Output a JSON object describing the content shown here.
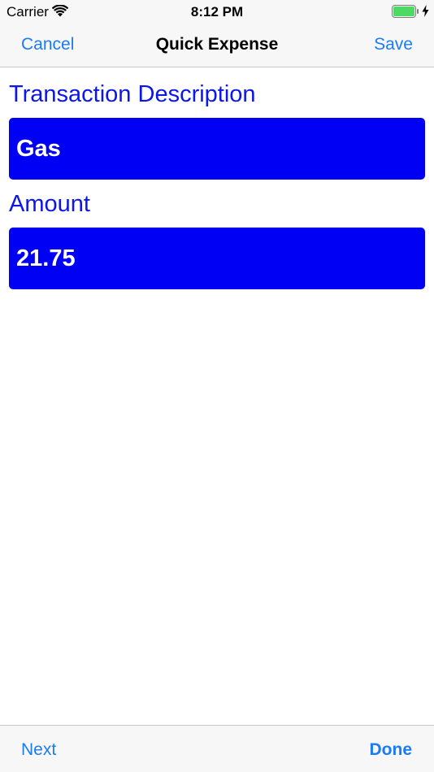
{
  "status_bar": {
    "carrier": "Carrier",
    "time": "8:12 PM",
    "icons": [
      "wifi-icon",
      "battery-icon",
      "charging-icon"
    ]
  },
  "nav": {
    "cancel_label": "Cancel",
    "title": "Quick Expense",
    "save_label": "Save"
  },
  "form": {
    "description_label": "Transaction Description",
    "description_value": "Gas",
    "amount_label": "Amount",
    "amount_value": "21.75"
  },
  "toolbar": {
    "next_label": "Next",
    "done_label": "Done"
  },
  "colors": {
    "accent": "#1a7cf5",
    "label": "#0d16e8",
    "field_background": "#0000f5",
    "field_text": "#ffffff",
    "battery": "#4cd964"
  }
}
